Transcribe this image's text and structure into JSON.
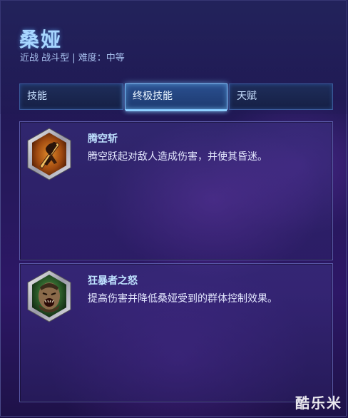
{
  "hero": {
    "name": "桑娅",
    "subtitle": "近战 战斗型 | 难度：中等"
  },
  "tabs": [
    {
      "label": "技能",
      "active": false
    },
    {
      "label": "终极技能",
      "active": true
    },
    {
      "label": "天赋",
      "active": false
    }
  ],
  "abilities": [
    {
      "name": "腾空斩",
      "description": "腾空跃起对敌人造成伤害，并使其昏迷。",
      "icon": "leap-strike-icon"
    },
    {
      "name": "狂暴者之怒",
      "description": "提高伤害并降低桑娅受到的群体控制效果。",
      "icon": "wrath-berserker-icon"
    }
  ],
  "watermark": "酷乐米",
  "colors": {
    "accent": "#8fd0ff",
    "title": "#a7d6ff",
    "background": "#25185a"
  }
}
